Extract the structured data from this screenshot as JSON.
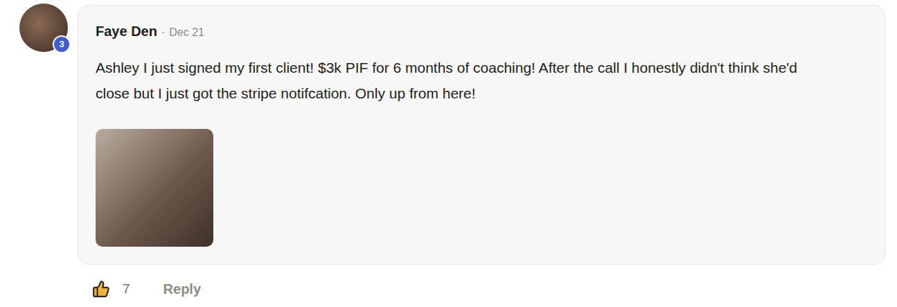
{
  "comment": {
    "author": "Faye Den",
    "separator": "·",
    "date": "Dec 21",
    "avatar_badge": "3",
    "text": "Ashley I just signed my first client! $3k PIF for 6 months of coaching! After the call I honestly didn't think she'd close but I just got the stripe notifcation. Only up from here!",
    "likes": "7",
    "reply": "Reply"
  }
}
